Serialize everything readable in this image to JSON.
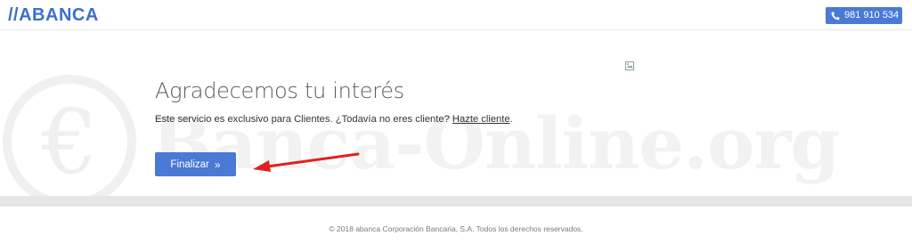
{
  "header": {
    "logo_text": "//ABANCA",
    "phone": {
      "icon": "phone-icon",
      "number": "981 910 534"
    }
  },
  "main": {
    "title": "Agradecemos tu interés",
    "description": "Este servicio es exclusivo para Clientes. ¿Todavía no eres cliente?",
    "link_text": "Hazte cliente",
    "period": ".",
    "finalize_label": "Finalizar",
    "finalize_chevron": "»"
  },
  "watermark": {
    "symbol": "€",
    "text": "Banca-Online.org"
  },
  "footer": {
    "copyright": "© 2018 abanca Corporación Bancaria, S.A. Todos los derechos reservados."
  },
  "colors": {
    "brand_blue": "#4a79d6",
    "logo_blue": "#3a6fd0",
    "arrow_red": "#e02020",
    "separator": "#e6e6e6"
  }
}
